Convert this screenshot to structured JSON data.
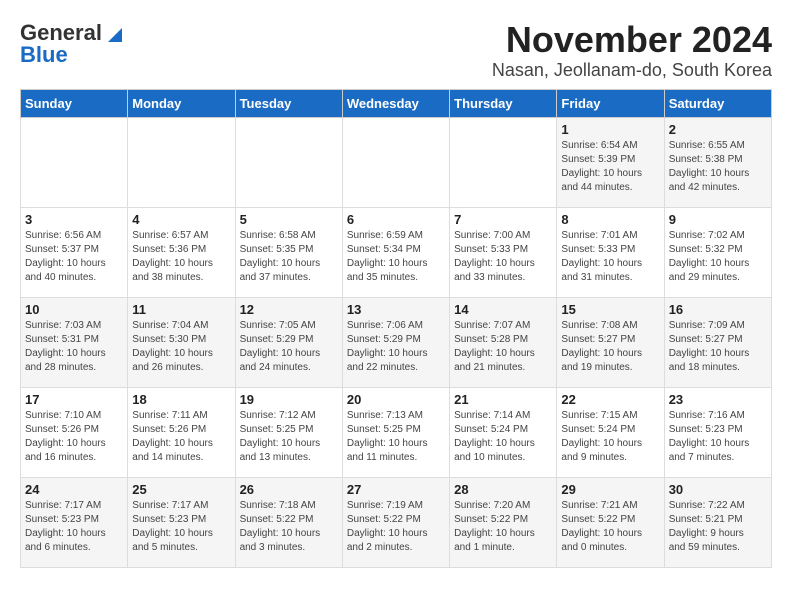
{
  "logo": {
    "line1": "General",
    "line2": "Blue"
  },
  "title": "November 2024",
  "subtitle": "Nasan, Jeollanam-do, South Korea",
  "headers": [
    "Sunday",
    "Monday",
    "Tuesday",
    "Wednesday",
    "Thursday",
    "Friday",
    "Saturday"
  ],
  "weeks": [
    [
      {
        "day": "",
        "info": ""
      },
      {
        "day": "",
        "info": ""
      },
      {
        "day": "",
        "info": ""
      },
      {
        "day": "",
        "info": ""
      },
      {
        "day": "",
        "info": ""
      },
      {
        "day": "1",
        "info": "Sunrise: 6:54 AM\nSunset: 5:39 PM\nDaylight: 10 hours\nand 44 minutes."
      },
      {
        "day": "2",
        "info": "Sunrise: 6:55 AM\nSunset: 5:38 PM\nDaylight: 10 hours\nand 42 minutes."
      }
    ],
    [
      {
        "day": "3",
        "info": "Sunrise: 6:56 AM\nSunset: 5:37 PM\nDaylight: 10 hours\nand 40 minutes."
      },
      {
        "day": "4",
        "info": "Sunrise: 6:57 AM\nSunset: 5:36 PM\nDaylight: 10 hours\nand 38 minutes."
      },
      {
        "day": "5",
        "info": "Sunrise: 6:58 AM\nSunset: 5:35 PM\nDaylight: 10 hours\nand 37 minutes."
      },
      {
        "day": "6",
        "info": "Sunrise: 6:59 AM\nSunset: 5:34 PM\nDaylight: 10 hours\nand 35 minutes."
      },
      {
        "day": "7",
        "info": "Sunrise: 7:00 AM\nSunset: 5:33 PM\nDaylight: 10 hours\nand 33 minutes."
      },
      {
        "day": "8",
        "info": "Sunrise: 7:01 AM\nSunset: 5:33 PM\nDaylight: 10 hours\nand 31 minutes."
      },
      {
        "day": "9",
        "info": "Sunrise: 7:02 AM\nSunset: 5:32 PM\nDaylight: 10 hours\nand 29 minutes."
      }
    ],
    [
      {
        "day": "10",
        "info": "Sunrise: 7:03 AM\nSunset: 5:31 PM\nDaylight: 10 hours\nand 28 minutes."
      },
      {
        "day": "11",
        "info": "Sunrise: 7:04 AM\nSunset: 5:30 PM\nDaylight: 10 hours\nand 26 minutes."
      },
      {
        "day": "12",
        "info": "Sunrise: 7:05 AM\nSunset: 5:29 PM\nDaylight: 10 hours\nand 24 minutes."
      },
      {
        "day": "13",
        "info": "Sunrise: 7:06 AM\nSunset: 5:29 PM\nDaylight: 10 hours\nand 22 minutes."
      },
      {
        "day": "14",
        "info": "Sunrise: 7:07 AM\nSunset: 5:28 PM\nDaylight: 10 hours\nand 21 minutes."
      },
      {
        "day": "15",
        "info": "Sunrise: 7:08 AM\nSunset: 5:27 PM\nDaylight: 10 hours\nand 19 minutes."
      },
      {
        "day": "16",
        "info": "Sunrise: 7:09 AM\nSunset: 5:27 PM\nDaylight: 10 hours\nand 18 minutes."
      }
    ],
    [
      {
        "day": "17",
        "info": "Sunrise: 7:10 AM\nSunset: 5:26 PM\nDaylight: 10 hours\nand 16 minutes."
      },
      {
        "day": "18",
        "info": "Sunrise: 7:11 AM\nSunset: 5:26 PM\nDaylight: 10 hours\nand 14 minutes."
      },
      {
        "day": "19",
        "info": "Sunrise: 7:12 AM\nSunset: 5:25 PM\nDaylight: 10 hours\nand 13 minutes."
      },
      {
        "day": "20",
        "info": "Sunrise: 7:13 AM\nSunset: 5:25 PM\nDaylight: 10 hours\nand 11 minutes."
      },
      {
        "day": "21",
        "info": "Sunrise: 7:14 AM\nSunset: 5:24 PM\nDaylight: 10 hours\nand 10 minutes."
      },
      {
        "day": "22",
        "info": "Sunrise: 7:15 AM\nSunset: 5:24 PM\nDaylight: 10 hours\nand 9 minutes."
      },
      {
        "day": "23",
        "info": "Sunrise: 7:16 AM\nSunset: 5:23 PM\nDaylight: 10 hours\nand 7 minutes."
      }
    ],
    [
      {
        "day": "24",
        "info": "Sunrise: 7:17 AM\nSunset: 5:23 PM\nDaylight: 10 hours\nand 6 minutes."
      },
      {
        "day": "25",
        "info": "Sunrise: 7:17 AM\nSunset: 5:23 PM\nDaylight: 10 hours\nand 5 minutes."
      },
      {
        "day": "26",
        "info": "Sunrise: 7:18 AM\nSunset: 5:22 PM\nDaylight: 10 hours\nand 3 minutes."
      },
      {
        "day": "27",
        "info": "Sunrise: 7:19 AM\nSunset: 5:22 PM\nDaylight: 10 hours\nand 2 minutes."
      },
      {
        "day": "28",
        "info": "Sunrise: 7:20 AM\nSunset: 5:22 PM\nDaylight: 10 hours\nand 1 minute."
      },
      {
        "day": "29",
        "info": "Sunrise: 7:21 AM\nSunset: 5:22 PM\nDaylight: 10 hours\nand 0 minutes."
      },
      {
        "day": "30",
        "info": "Sunrise: 7:22 AM\nSunset: 5:21 PM\nDaylight: 9 hours\nand 59 minutes."
      }
    ]
  ]
}
